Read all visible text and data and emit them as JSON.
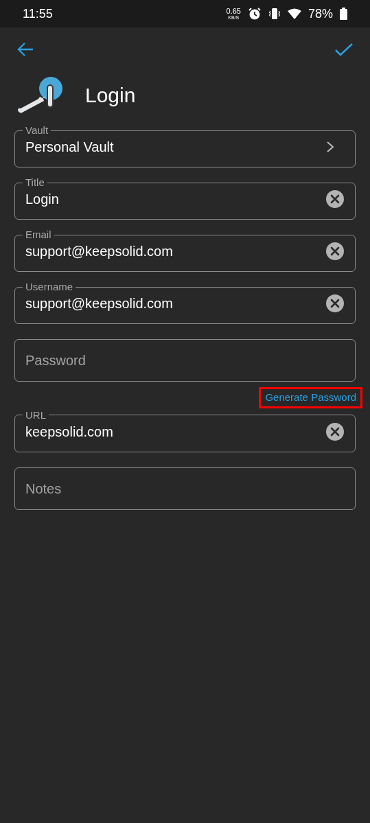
{
  "status_bar": {
    "time": "11:55",
    "speed_value": "0.65",
    "speed_unit": "KB/S",
    "battery": "78%"
  },
  "header": {
    "title": "Login"
  },
  "fields": [
    {
      "kind": "select",
      "label": "Vault",
      "value": "Personal Vault"
    },
    {
      "kind": "text",
      "label": "Title",
      "value": "Login"
    },
    {
      "kind": "text",
      "label": "Email",
      "value": "support@keepsolid.com"
    },
    {
      "kind": "text",
      "label": "Username",
      "value": "support@keepsolid.com"
    },
    {
      "kind": "empty",
      "placeholder": "Password"
    },
    {
      "kind": "link",
      "label": "Generate Password",
      "highlighted": true
    },
    {
      "kind": "text",
      "label": "URL",
      "value": "keepsolid.com"
    },
    {
      "kind": "empty",
      "placeholder": "Notes"
    }
  ]
}
